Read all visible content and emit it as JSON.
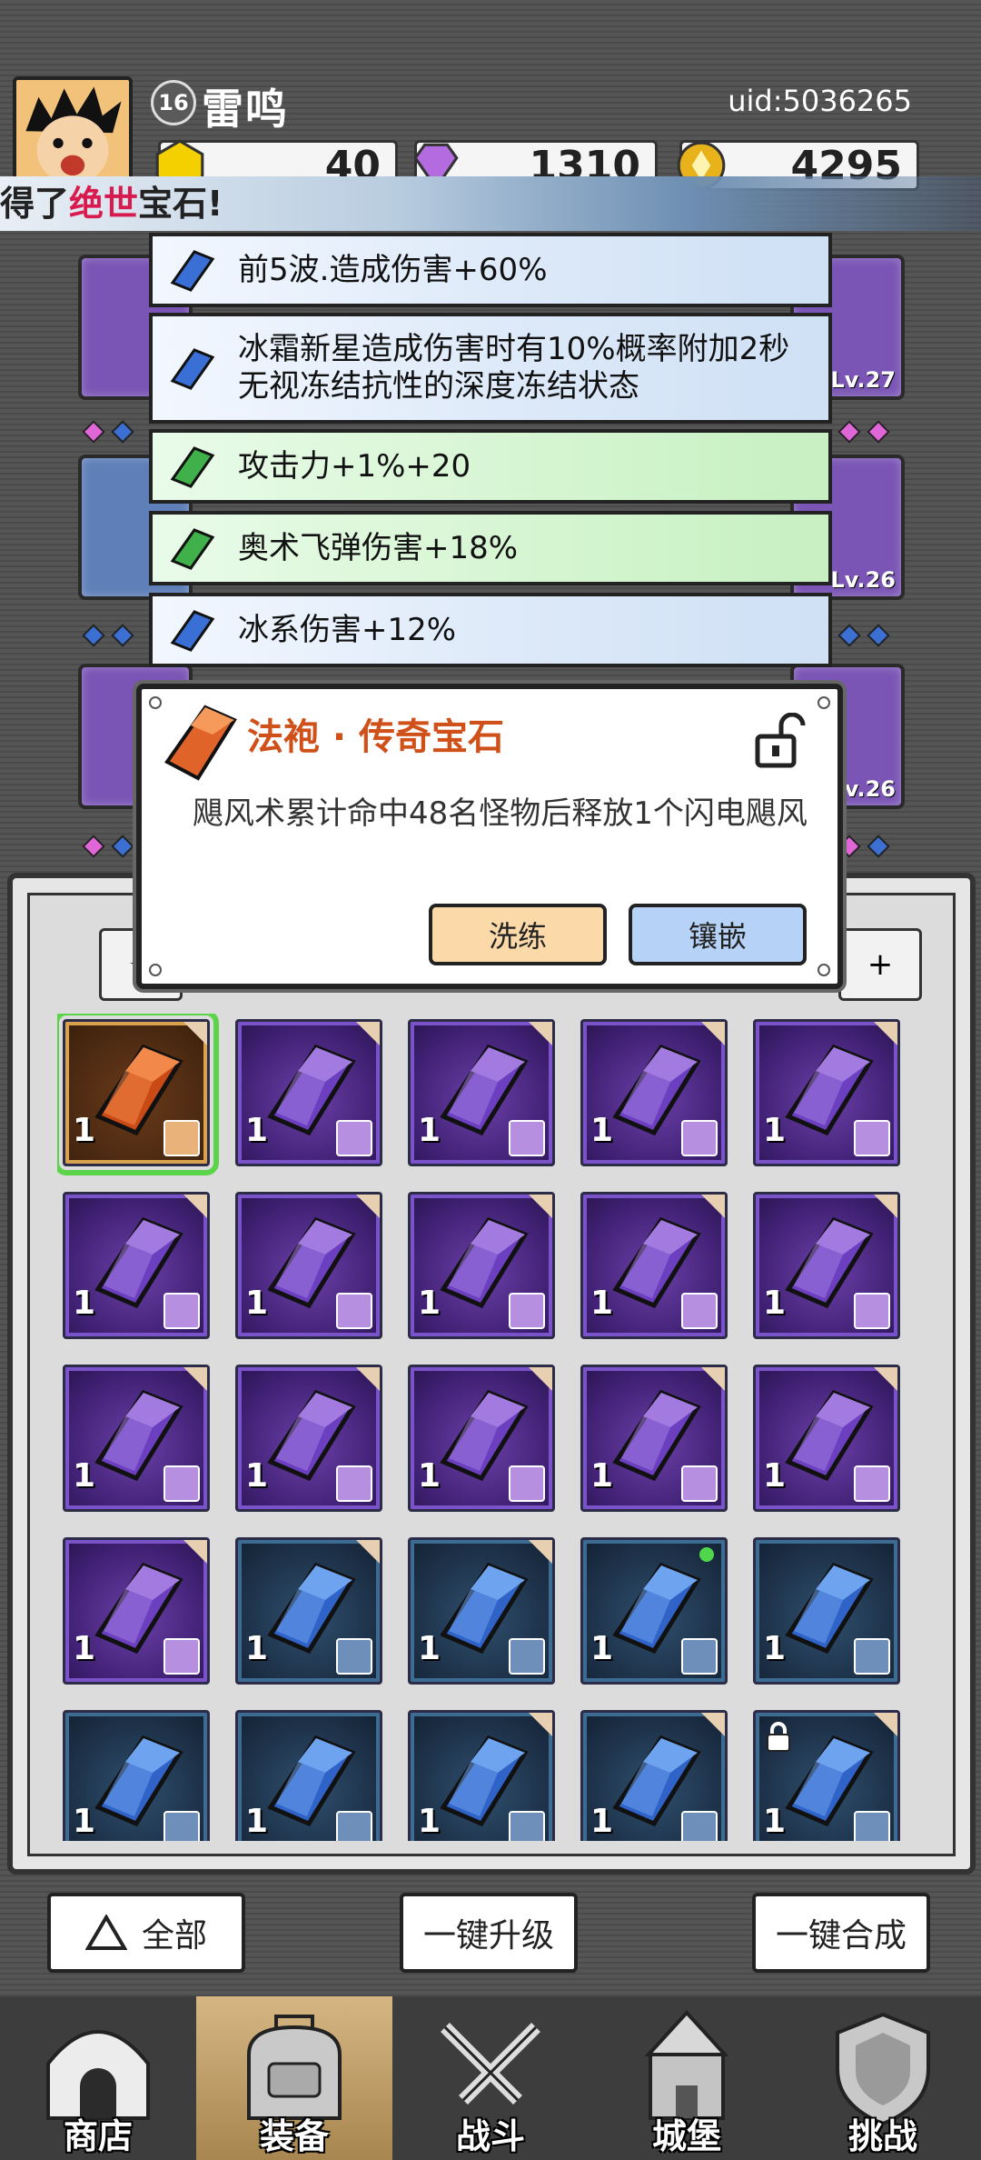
{
  "player": {
    "level": "16",
    "name": "雷鸣",
    "uid": "uid:5036265"
  },
  "currencies": [
    {
      "name": "energy",
      "icon": "gold-gem-icon",
      "value": "40"
    },
    {
      "name": "diamond",
      "icon": "diamond-icon",
      "value": "1310"
    },
    {
      "name": "coin",
      "icon": "coin-icon",
      "value": "4295"
    }
  ],
  "banner": {
    "prefix": "得了",
    "highlight": "绝世",
    "suffix": "宝石!"
  },
  "equipment": {
    "levels": [
      "Lv.27",
      "Lv.26",
      "Lv.26"
    ]
  },
  "affixes": [
    {
      "text": "前5波.造成伤害+60%",
      "color": "blue"
    },
    {
      "text": "冰霜新星造成伤害时有10%概率附加2秒无视冻结抗性的深度冻结状态",
      "color": "blue"
    },
    {
      "text": "攻击力+1%+20",
      "color": "green"
    },
    {
      "text": "奥术飞弹伤害+18%",
      "color": "green"
    },
    {
      "text": "冰系伤害+12%",
      "color": "blue"
    }
  ],
  "popup": {
    "title": "法袍 · 传奇宝石",
    "description": "飓风术累计命中48名怪物后释放1个闪电飓风",
    "wash_label": "洗练",
    "inlay_label": "镶嵌"
  },
  "filters": {
    "left_symbol": "✧",
    "right_symbol": "+"
  },
  "inventory": {
    "items": [
      {
        "color": "orange",
        "count": "1",
        "selected": true,
        "corner": true
      },
      {
        "color": "purple",
        "count": "1",
        "corner": true
      },
      {
        "color": "purple",
        "count": "1",
        "corner": true
      },
      {
        "color": "purple",
        "count": "1",
        "corner": true
      },
      {
        "color": "purple",
        "count": "1",
        "corner": true
      },
      {
        "color": "purple",
        "count": "1",
        "corner": true
      },
      {
        "color": "purple",
        "count": "1",
        "corner": true
      },
      {
        "color": "purple",
        "count": "1",
        "corner": true
      },
      {
        "color": "purple",
        "count": "1",
        "corner": true
      },
      {
        "color": "purple",
        "count": "1",
        "corner": true
      },
      {
        "color": "purple",
        "count": "1",
        "corner": true
      },
      {
        "color": "purple",
        "count": "1",
        "corner": true
      },
      {
        "color": "purple",
        "count": "1",
        "corner": true
      },
      {
        "color": "purple",
        "count": "1",
        "corner": true
      },
      {
        "color": "purple",
        "count": "1",
        "corner": true
      },
      {
        "color": "purple",
        "count": "1",
        "corner": true
      },
      {
        "color": "blue",
        "count": "1",
        "corner": true
      },
      {
        "color": "blue",
        "count": "1",
        "corner": true
      },
      {
        "color": "blue",
        "count": "1",
        "dot": true
      },
      {
        "color": "blue",
        "count": "1"
      },
      {
        "color": "blue",
        "count": "1"
      },
      {
        "color": "blue",
        "count": "1"
      },
      {
        "color": "blue",
        "count": "1",
        "corner": true
      },
      {
        "color": "blue",
        "count": "1",
        "corner": true
      },
      {
        "color": "blue",
        "count": "1",
        "corner": true,
        "locked": true
      }
    ]
  },
  "actions": {
    "all_label": "全部",
    "upgrade_label": "一键升级",
    "merge_label": "一键合成"
  },
  "nav": [
    {
      "label": "商店",
      "icon": "shop-icon"
    },
    {
      "label": "装备",
      "icon": "backpack-icon",
      "active": true
    },
    {
      "label": "战斗",
      "icon": "swords-icon"
    },
    {
      "label": "城堡",
      "icon": "castle-icon"
    },
    {
      "label": "挑战",
      "icon": "shield-icon"
    }
  ],
  "colors": {
    "accent_orange": "#d0501a",
    "highlight_red": "#d81b4f",
    "select_green": "#5cd44a"
  }
}
